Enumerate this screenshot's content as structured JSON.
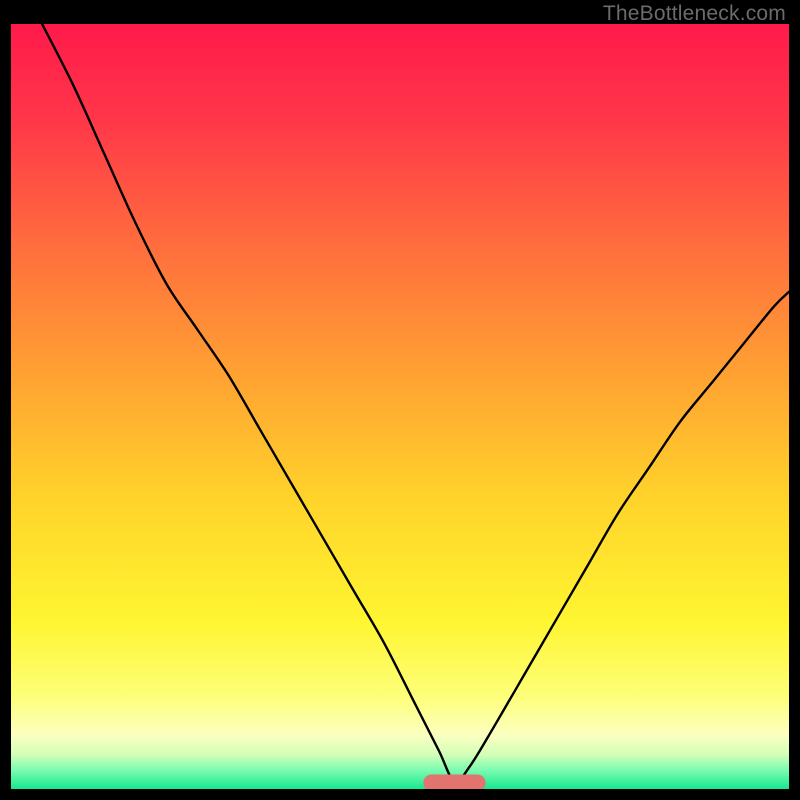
{
  "watermark": "TheBottleneck.com",
  "chart_data": {
    "type": "line",
    "title": "",
    "xlabel": "",
    "ylabel": "",
    "xlim": [
      0,
      100
    ],
    "ylim": [
      0,
      100
    ],
    "grid": false,
    "legend": false,
    "background_gradient": {
      "stops": [
        {
          "offset": 0.0,
          "color": "#ff1a4b"
        },
        {
          "offset": 0.12,
          "color": "#ff3549"
        },
        {
          "offset": 0.28,
          "color": "#ff6a3e"
        },
        {
          "offset": 0.45,
          "color": "#ff9f33"
        },
        {
          "offset": 0.62,
          "color": "#ffd32a"
        },
        {
          "offset": 0.78,
          "color": "#fff531"
        },
        {
          "offset": 0.88,
          "color": "#feff7a"
        },
        {
          "offset": 0.93,
          "color": "#fbffc0"
        },
        {
          "offset": 0.955,
          "color": "#d3ffb8"
        },
        {
          "offset": 0.975,
          "color": "#7cfcb0"
        },
        {
          "offset": 1.0,
          "color": "#17e88f"
        }
      ]
    },
    "marker": {
      "x_center": 57.0,
      "y": 0.8,
      "width": 8.0,
      "height": 2.2,
      "color": "#e2736f",
      "shape": "capsule"
    },
    "series": [
      {
        "name": "curve",
        "color": "#000000",
        "stroke_width": 2.4,
        "x": [
          4,
          8,
          12,
          16,
          20,
          24,
          28,
          32,
          36,
          40,
          44,
          48,
          52,
          55,
          57,
          59,
          62,
          66,
          70,
          74,
          78,
          82,
          86,
          90,
          94,
          98,
          100
        ],
        "y": [
          100,
          92,
          83,
          74,
          66,
          60,
          54,
          47,
          40,
          33,
          26,
          19,
          11,
          5,
          1,
          3,
          8,
          15,
          22,
          29,
          36,
          42,
          48,
          53,
          58,
          63,
          65
        ]
      }
    ]
  }
}
